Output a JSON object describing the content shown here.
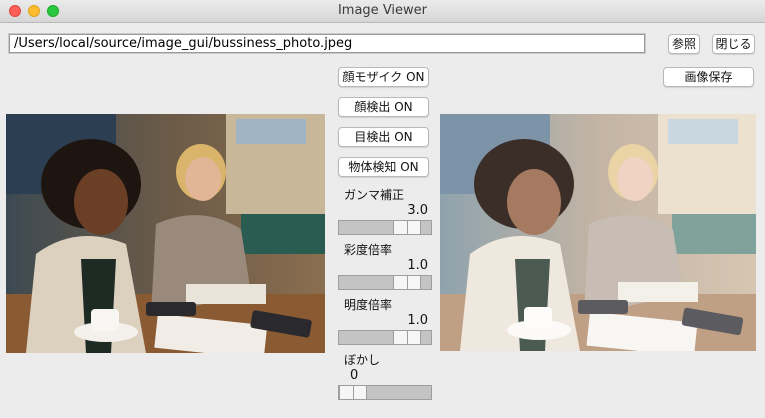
{
  "window": {
    "title": "Image Viewer"
  },
  "toolbar": {
    "file_path": "/Users/local/source/image_gui/bussiness_photo.jpeg",
    "browse_label": "参照",
    "close_label": "閉じる",
    "save_label": "画像保存"
  },
  "controls": {
    "face_mosaic_label": "顔モザイク ON",
    "face_detect_label": "顔検出 ON",
    "eye_detect_label": "目検出 ON",
    "object_detect_label": "物体検知 ON",
    "gamma": {
      "label": "ガンマ補正",
      "value": "3.0",
      "position": 0.85
    },
    "saturation": {
      "label": "彩度倍率",
      "value": "1.0",
      "position": 0.85
    },
    "brightness": {
      "label": "明度倍率",
      "value": "1.0",
      "position": 0.85
    },
    "blur": {
      "label": "ぼかし",
      "value": "0",
      "position": 0.0
    }
  },
  "images": {
    "original_icon": "photo-original",
    "processed_icon": "photo-processed"
  }
}
